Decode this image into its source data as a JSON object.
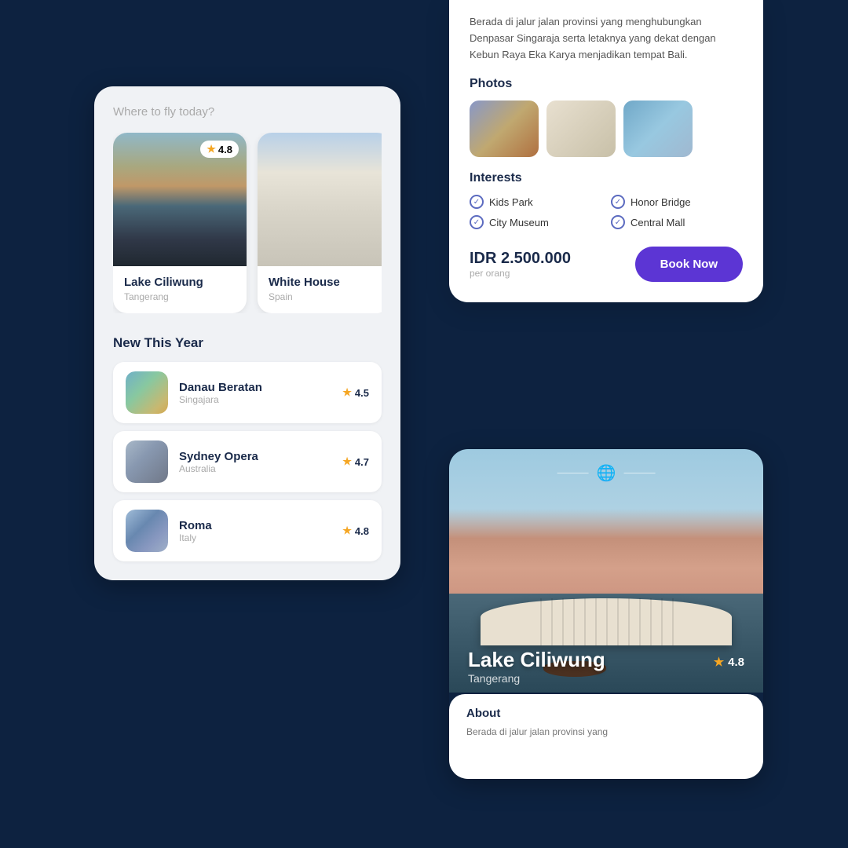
{
  "background": "#0d2240",
  "left_panel": {
    "search_placeholder": "Where to fly today?",
    "featured_cards": [
      {
        "name": "Lake Ciliwung",
        "location": "Tangerang",
        "rating": "4.8"
      },
      {
        "name": "White House",
        "location": "Spain",
        "rating": ""
      }
    ],
    "new_section_title": "New This Year",
    "new_items": [
      {
        "name": "Danau Beratan",
        "location": "Singajara",
        "rating": "4.5"
      },
      {
        "name": "Sydney Opera",
        "location": "Australia",
        "rating": "4.7"
      },
      {
        "name": "Roma",
        "location": "Italy",
        "rating": "4.8"
      }
    ]
  },
  "detail_card": {
    "description": "Berada di jalur jalan provinsi yang menghubungkan Denpasar Singaraja serta letaknya yang dekat dengan Kebun Raya Eka Karya menjadikan tempat Bali.",
    "photos_title": "Photos",
    "interests_title": "Interests",
    "interests": [
      {
        "label": "Kids Park"
      },
      {
        "label": "Honor Bridge"
      },
      {
        "label": "City Museum"
      },
      {
        "label": "Central Mall"
      }
    ],
    "price": "IDR 2.500.000",
    "price_sub": "per orang",
    "book_btn": "Book Now"
  },
  "bottom_card": {
    "place_name": "Lake Ciliwung",
    "location": "Tangerang",
    "rating": "4.8",
    "about_title": "About",
    "about_text": "Berada di jalur jalan provinsi yang"
  }
}
